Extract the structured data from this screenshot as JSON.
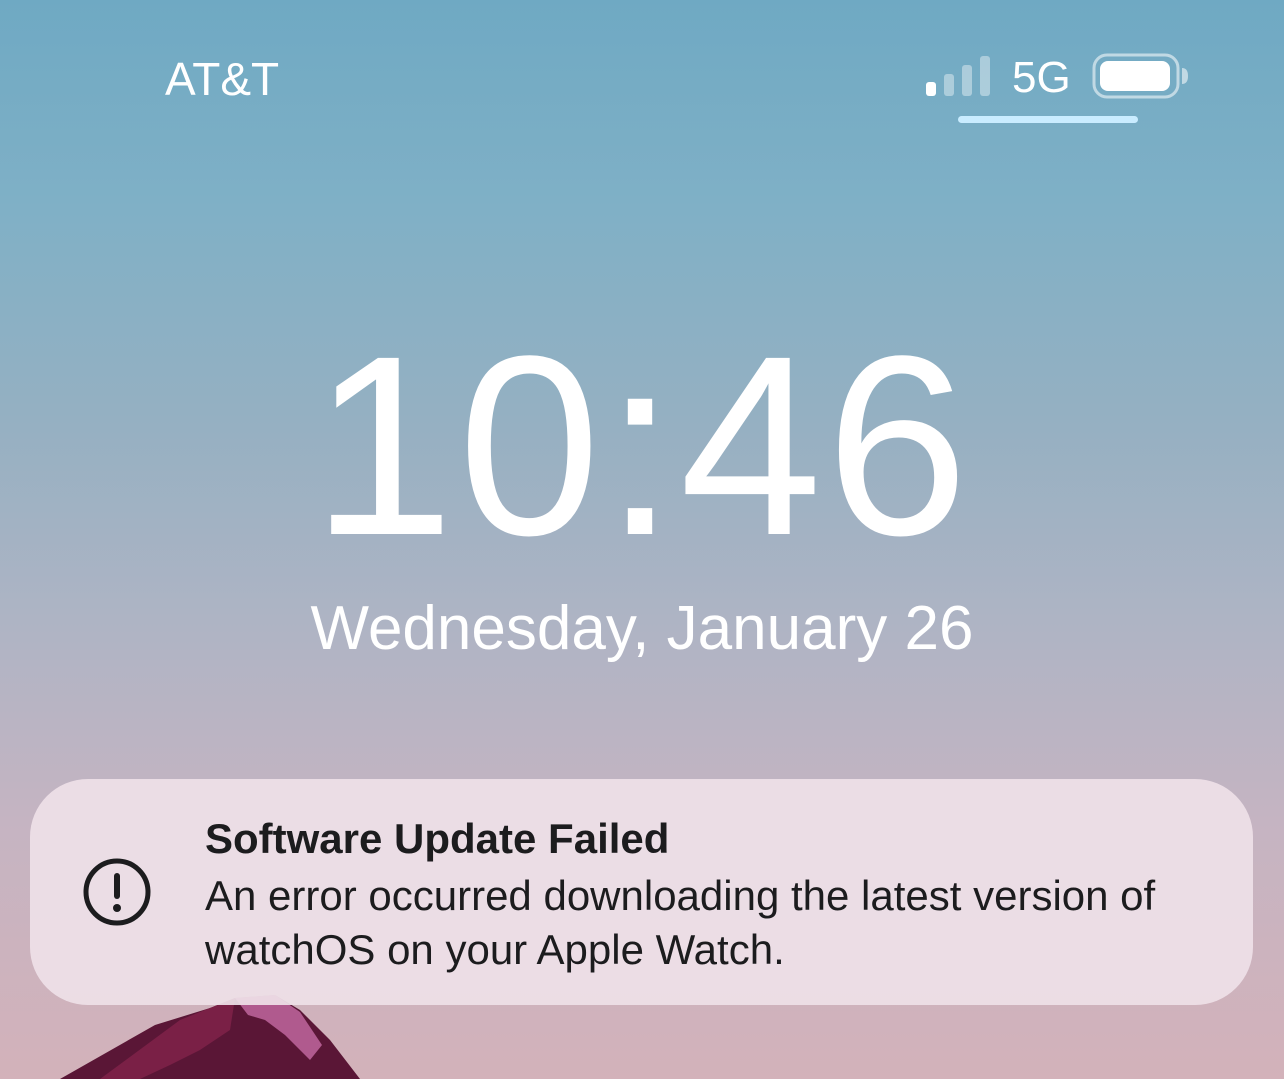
{
  "status_bar": {
    "carrier": "AT&T",
    "network": "5G",
    "signal_bars_active": 1,
    "signal_bars_total": 4,
    "battery_level": 0.9,
    "icons": [
      "signal-icon",
      "battery-icon"
    ]
  },
  "lock_screen": {
    "time": "10:46",
    "date": "Wednesday, January 26"
  },
  "notification": {
    "icon": "exclamation-circle-icon",
    "title": "Software Update Failed",
    "body": "An error occurred downloading the latest version of watchOS on your Apple Watch."
  },
  "colors": {
    "text": "#ffffff",
    "notification_bg": "#eee0e7",
    "notification_text": "#1c1c1e",
    "home_indicator": "#c9ecff",
    "mountain_dark": "#5a1636",
    "mountain_light": "#b05a8e"
  }
}
